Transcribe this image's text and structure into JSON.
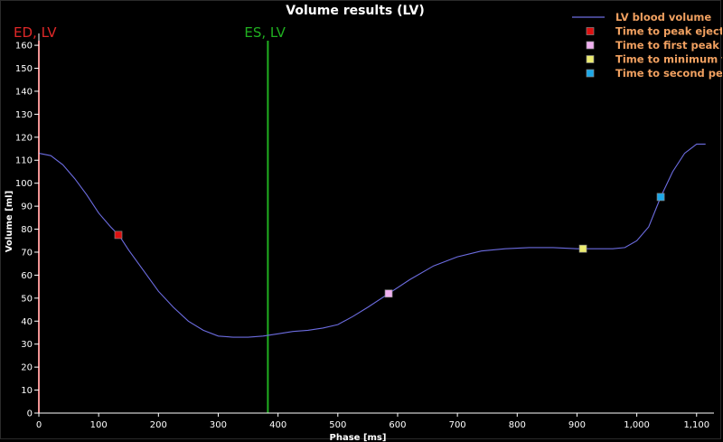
{
  "chart_data": {
    "type": "line",
    "title": "Volume results (LV)",
    "xlabel": "Phase [ms]",
    "ylabel": "Volume [ml]",
    "xlim": [
      0,
      1120
    ],
    "ylim": [
      0,
      162
    ],
    "x_ticks": [
      0,
      100,
      200,
      300,
      400,
      500,
      600,
      700,
      800,
      900,
      1000,
      1100
    ],
    "x_tick_labels": [
      "0",
      "100",
      "200",
      "300",
      "400",
      "500",
      "600",
      "700",
      "800",
      "900",
      "1,000",
      "1,100"
    ],
    "y_ticks": [
      0,
      10,
      20,
      30,
      40,
      50,
      60,
      70,
      80,
      90,
      100,
      110,
      120,
      130,
      140,
      150,
      160
    ],
    "series": [
      {
        "name": "LV blood volume",
        "color": "#6c6ce0",
        "x": [
          0,
          20,
          40,
          60,
          80,
          100,
          120,
          135,
          150,
          175,
          200,
          225,
          250,
          275,
          300,
          325,
          350,
          375,
          400,
          425,
          450,
          475,
          500,
          525,
          550,
          585,
          620,
          660,
          700,
          740,
          780,
          820,
          860,
          900,
          930,
          960,
          980,
          1000,
          1020,
          1040,
          1060,
          1080,
          1100,
          1115
        ],
        "y": [
          113,
          112,
          108,
          102,
          95,
          87,
          81,
          77,
          71,
          62,
          53,
          46,
          40,
          36,
          33.5,
          33,
          33,
          33.5,
          34.5,
          35.5,
          36,
          37,
          38.5,
          42,
          46,
          52,
          58,
          64,
          68,
          70.5,
          71.5,
          72,
          72,
          71.5,
          71.5,
          71.5,
          72,
          75,
          81,
          94,
          105,
          113,
          117,
          117
        ]
      }
    ],
    "markers": [
      {
        "name": "Time to peak ejection",
        "x": 133,
        "y": 77.5,
        "color": "#dd1111"
      },
      {
        "name": "Time to first peak filling",
        "x": 585,
        "y": 52,
        "color": "#f0b0f0"
      },
      {
        "name": "Time to minimum filling",
        "x": 910,
        "y": 71.5,
        "color": "#ecec70"
      },
      {
        "name": "Time to second peak filling",
        "x": 1040,
        "y": 94,
        "color": "#1ca8e8"
      }
    ],
    "vertical_lines": [
      {
        "label": "ED, LV",
        "x": 0,
        "color": "#e02828"
      },
      {
        "label": "ES, LV",
        "x": 383,
        "color": "#20b020"
      }
    ],
    "legend": {
      "placement": "top-right",
      "text_color": "#f0a060",
      "entries": [
        "LV blood volume",
        "Time to peak ejection",
        "Time to first peak filling",
        "Time to minimum filling",
        "Time to second peak filling"
      ]
    },
    "grid": false
  }
}
